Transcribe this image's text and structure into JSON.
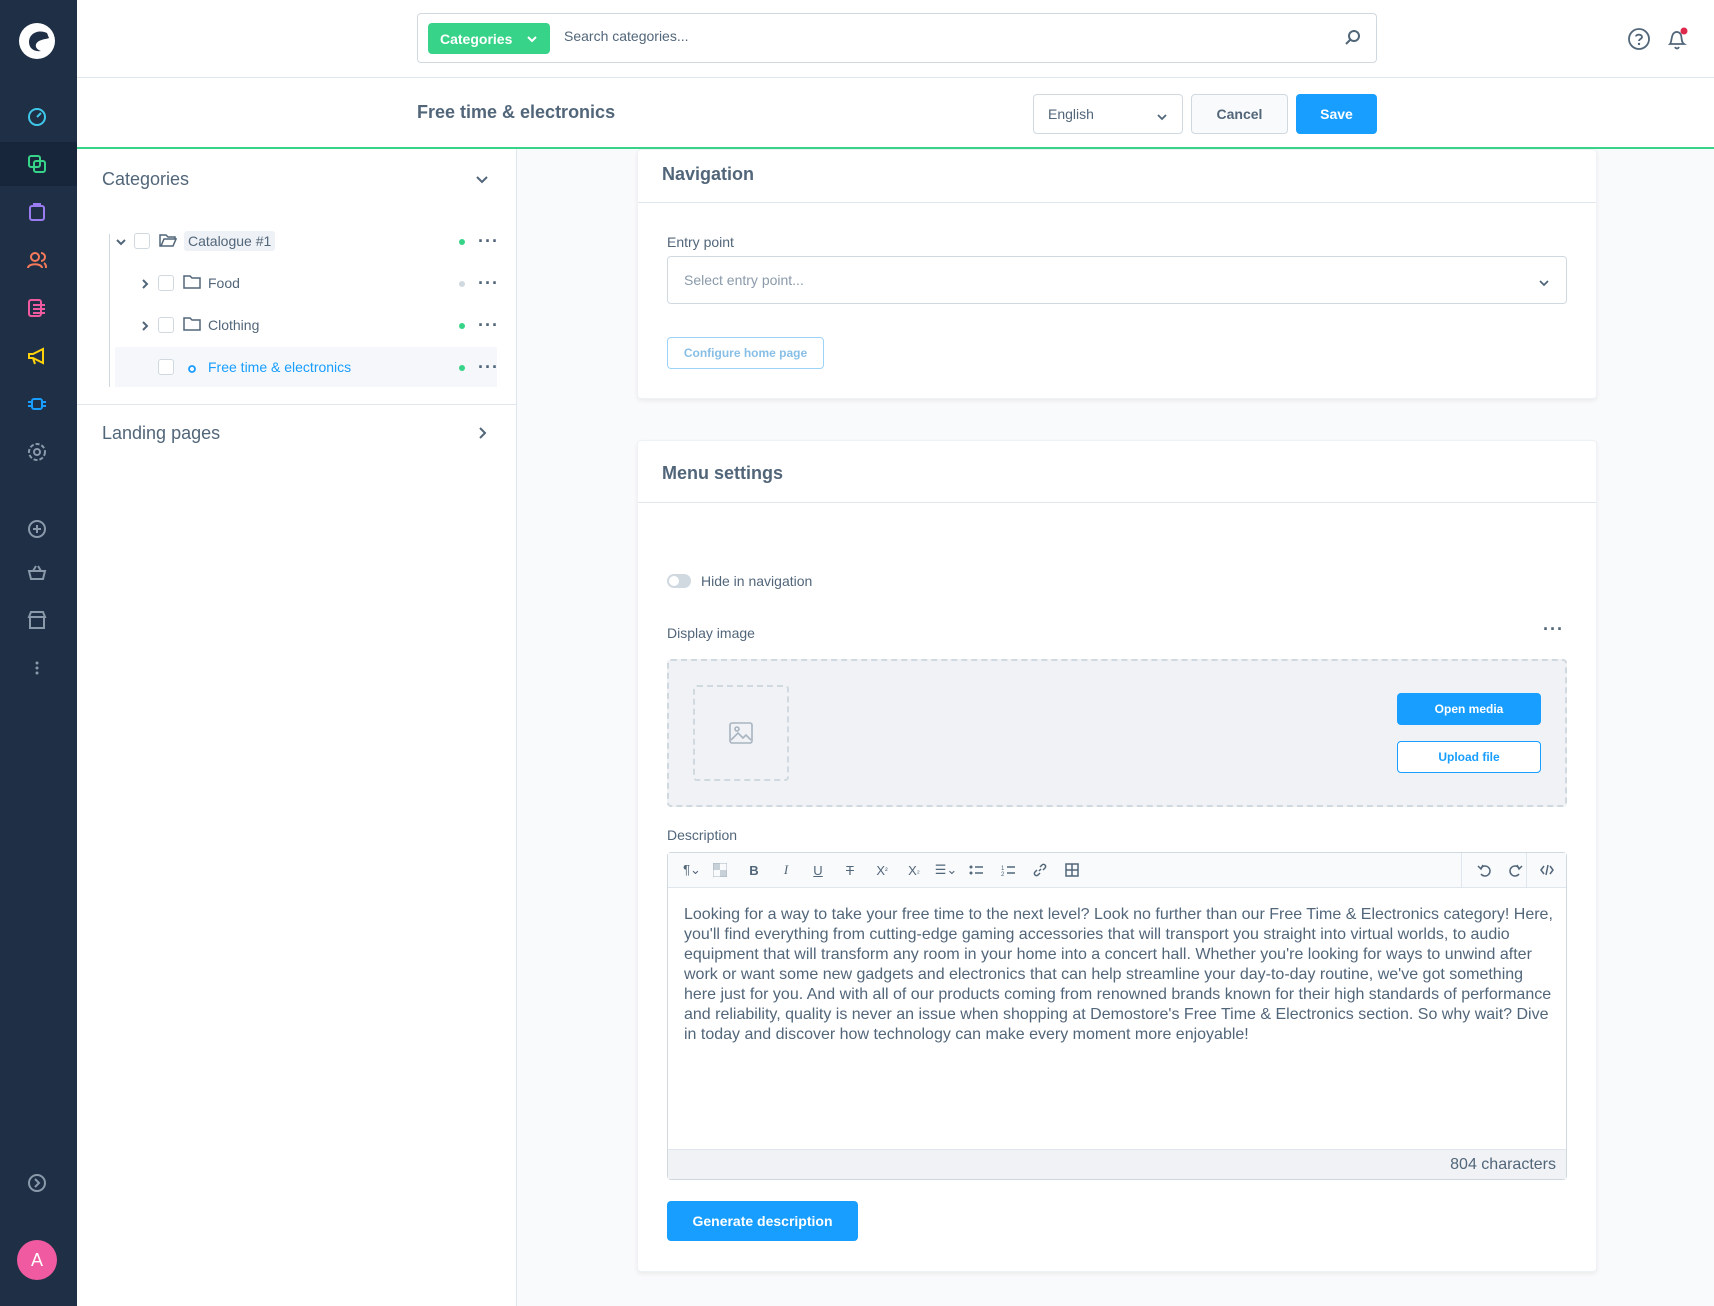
{
  "search": {
    "type_label": "Categories",
    "placeholder": "Search categories..."
  },
  "header": {
    "title": "Free time & electronics",
    "language": "English",
    "cancel_label": "Cancel",
    "save_label": "Save"
  },
  "rail": {
    "avatar_initial": "A",
    "icons": [
      "dashboard-icon",
      "catalogues-icon",
      "orders-icon",
      "customers-icon",
      "content-icon",
      "marketing-icon",
      "extensions-icon",
      "settings-icon",
      "add-icon",
      "basket-icon",
      "store-icon",
      "more-icon",
      "expand-icon"
    ]
  },
  "tree": {
    "categories_heading": "Categories",
    "landing_pages_heading": "Landing pages",
    "items": [
      {
        "label": "Catalogue #1",
        "active": true
      },
      {
        "label": "Food",
        "active": false
      },
      {
        "label": "Clothing",
        "active": true
      },
      {
        "label": "Free time & electronics",
        "active": true
      }
    ]
  },
  "navigation_card": {
    "title": "Navigation",
    "entry_point_label": "Entry point",
    "entry_point_placeholder": "Select entry point...",
    "configure_label": "Configure home page"
  },
  "menu_card": {
    "title": "Menu settings",
    "hide_label": "Hide in navigation",
    "hide_value": false,
    "display_image_label": "Display image",
    "open_media_label": "Open media",
    "upload_label": "Upload file",
    "description_label": "Description",
    "description_text": "Looking for a way to take your free time to the next level? Look no further than our Free Time & Electronics category! Here, you'll find everything from cutting-edge gaming accessories that will transport you straight into virtual worlds, to audio equipment that will transform any room in your home into a concert hall. Whether you're looking for ways to unwind after work or want some new gadgets and electronics that can help streamline your day-to-day routine, we've got something here just for you. And with all of our products coming from renowned brands known for their high standards of performance and reliability, quality is never an issue when shopping at Demostore's Free Time & Electronics section. So why wait? Dive in today and discover how technology can make every moment more enjoyable!",
    "char_count": "804 characters",
    "generate_label": "Generate description"
  },
  "colors": {
    "accent": "#189eff",
    "green": "#37d388",
    "rail": "#1f2f46",
    "inactive_dot": "#d1d9e0"
  }
}
